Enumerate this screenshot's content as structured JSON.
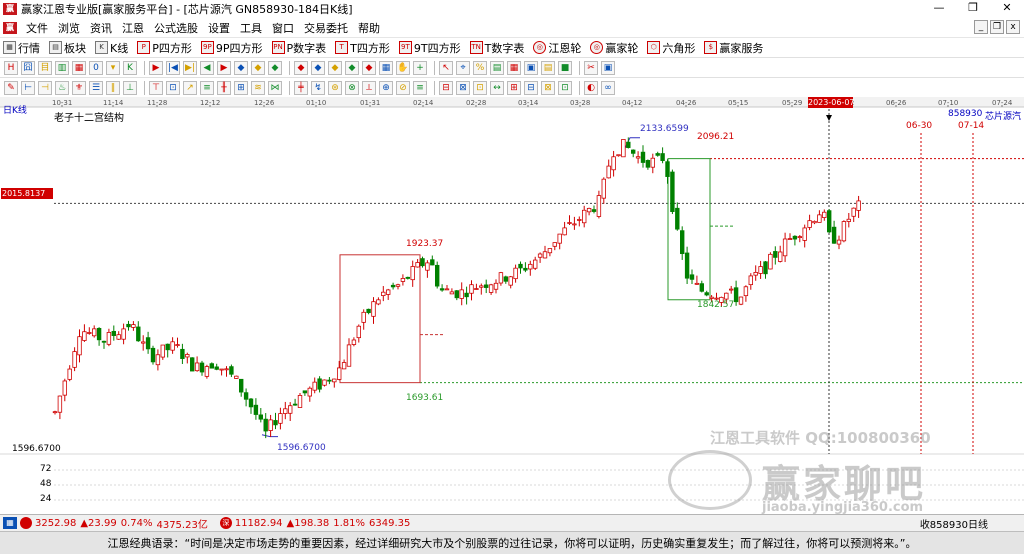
{
  "titlebar": {
    "app_icon": "yingjia-logo-icon",
    "title": "赢家江恩专业版[赢家服务平台] - [芯片源汽  GN858930-184日K线]",
    "minimize": "—",
    "restore": "❐",
    "close": "✕"
  },
  "menubar": {
    "items": [
      "文件",
      "浏览",
      "资讯",
      "江恩",
      "公式选股",
      "设置",
      "工具",
      "窗口",
      "交易委托",
      "帮助"
    ],
    "mdi": [
      "_",
      "❐",
      "x"
    ]
  },
  "toolbar1": {
    "items": [
      {
        "icon": "grid-icon",
        "glyph": "▦",
        "label": "行情"
      },
      {
        "icon": "block-icon",
        "glyph": "▤",
        "label": "板块"
      },
      {
        "icon": "kline-icon",
        "glyph": "K",
        "label": "K线"
      },
      {
        "icon": "p-square-icon",
        "glyph": "P",
        "label": "P四方形"
      },
      {
        "icon": "9p-square-icon",
        "glyph": "9P",
        "label": "9P四方形"
      },
      {
        "icon": "p-table-icon",
        "glyph": "PN",
        "label": "P数字表"
      },
      {
        "icon": "t-square-icon",
        "glyph": "T",
        "label": "T四方形"
      },
      {
        "icon": "9t-square-icon",
        "glyph": "9T",
        "label": "9T四方形"
      },
      {
        "icon": "t-table-icon",
        "glyph": "TN",
        "label": "T数字表"
      },
      {
        "icon": "jiangen-wheel-icon",
        "glyph": "◎",
        "label": "江恩轮"
      },
      {
        "icon": "yingjia-wheel-icon",
        "glyph": "◎",
        "label": "赢家轮"
      },
      {
        "icon": "hexagon-icon",
        "glyph": "⬡",
        "label": "六角形"
      },
      {
        "icon": "service-icon",
        "glyph": "$",
        "label": "赢家服务"
      }
    ]
  },
  "toolbar2": {
    "icons": [
      "H",
      "囧",
      "目",
      "▥",
      "▦",
      "0",
      "▾",
      "K",
      "▶",
      "|◀",
      "▶|",
      "◀",
      "▶",
      "◆",
      "◆",
      "◆",
      "◆",
      "◆",
      "◆",
      "◆",
      "◆",
      "▦",
      "✋",
      "+",
      "↖",
      "⌖",
      "%",
      "▤",
      "▦",
      "▣",
      "▤",
      "■",
      "✂",
      "▣"
    ]
  },
  "toolbar3": {
    "icons": [
      "✎",
      "⊢",
      "⊣",
      "♨",
      "⚜",
      "☰",
      "‖",
      "⊥",
      "⊤",
      "⊡",
      "↗",
      "≡",
      "╫",
      "⊞",
      "≋",
      "⋈",
      "╪",
      "↯",
      "⊛",
      "⊗",
      "⟂",
      "⊕",
      "⊘",
      "≡",
      "⊟",
      "⊠",
      "⊡",
      "↔",
      "⊞",
      "⊟",
      "⊠",
      "⊡",
      "◐",
      "∞"
    ]
  },
  "chart": {
    "period_label": "日K线",
    "structure_label": "老子十二宫结构",
    "symbol_code": "858930",
    "symbol_name": "芯片源汽",
    "price_tag": "2015.8137",
    "low_tag": "1596.6700",
    "date_highlight": "2023-06-07",
    "future_date1": "06-30",
    "future_date2": "07-14",
    "volume_ticks": [
      "72",
      "48",
      "24"
    ],
    "date_ticks": [
      "10-31",
      "11-14",
      "11-28",
      "12-12",
      "12-26",
      "01-10",
      "01-31",
      "02-14",
      "02-28",
      "03-14",
      "03-28",
      "04-12",
      "04-26",
      "05-15",
      "05-29",
      "06-12",
      "06-26",
      "07-10",
      "07-24"
    ],
    "annotations": {
      "high": "2133.6599",
      "target_high": "2096.21",
      "box1_top": "1923.37",
      "box1_bottom": "1693.61",
      "box2_bottom": "1842.57",
      "low": "1596.6700"
    },
    "watermark1": "江恩工具软件  QQ:100800360",
    "watermark2": "赢家聊吧",
    "watermark3": "jiaoba.yingjia360.com"
  },
  "chart_data": {
    "type": "candlestick",
    "symbol": "858930",
    "name": "芯片源汽",
    "period": "日K线",
    "x_ticks": [
      "10-31",
      "11-14",
      "11-28",
      "12-12",
      "12-26",
      "01-10",
      "01-31",
      "02-14",
      "02-28",
      "03-14",
      "03-28",
      "04-12",
      "04-26",
      "05-15",
      "05-29",
      "06-12",
      "06-26",
      "07-10",
      "07-24"
    ],
    "price_levels": {
      "current": 2015.8137,
      "high": 2133.6599,
      "target_high": 2096.21,
      "box1_top": 1923.37,
      "box1_bottom": 1693.61,
      "box2_bottom": 1842.57,
      "low": 1596.67
    },
    "ylim": [
      1560,
      2180
    ],
    "volume_ticks": [
      72,
      48,
      24
    ],
    "colors": {
      "up": "#d00000",
      "down": "#008000",
      "box1": "#c83232",
      "box2": "#2a9a2a",
      "pivot": "#3030c0"
    }
  },
  "statusbar": {
    "index1": {
      "icon": "sh-index-icon",
      "value": "3252.98",
      "change": "▲23.99",
      "percent": "0.74%",
      "amount": "4375.23亿"
    },
    "index2": {
      "icon": "sz-index-icon",
      "value": "11182.94",
      "change": "▲198.38",
      "percent": "1.81%",
      "amount": "6349.35"
    },
    "right_text": "收858930日线"
  },
  "quote": {
    "text": "江恩经典语录：“时间是决定市场走势的重要因素，经过详细研究大市及个别股票的过往记录，你将可以证明，历史确实重复发生；而了解过往，你将可以预测将来。”。"
  }
}
